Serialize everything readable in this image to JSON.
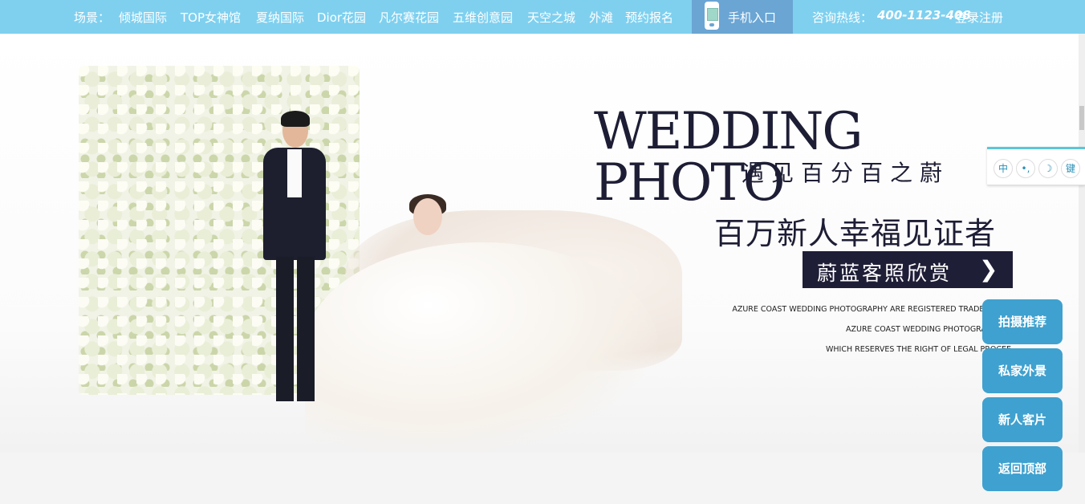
{
  "topbar": {
    "scene_label": "场景：",
    "nav_items": [
      "倾城国际",
      "TOP女神馆",
      "夏纳国际",
      "Dior花园",
      "凡尔赛花园",
      "五维创意园",
      "天空之城",
      "外滩",
      "预约报名"
    ],
    "mobile_entry": "手机入口",
    "hotline_label": "咨询热线：",
    "hotline_number": "400-1123-408",
    "login": "登录注册"
  },
  "banner": {
    "headline": "WEDDING PHOTO",
    "subtitle": "遇见百分百之蔚",
    "slogan": "百万新人幸福见证者",
    "button_label": "蔚蓝客照欣赏",
    "button_arrow": "❯",
    "trademark_lines": [
      "AZURE COAST WEDDING PHOTOGRAPHY ARE REGISTERED TRADEMARKS",
      "AZURE COAST WEDDING PHOTOGRAPHY W",
      "WHICH RESERVES THE RIGHT OF LEGAL PROCEE"
    ]
  },
  "ime": [
    "中",
    "•,",
    "☽",
    "键"
  ],
  "side_buttons": [
    "拍摄推荐",
    "私家外景",
    "新人客片",
    "返回顶部"
  ],
  "colors": {
    "topbar": "#7fd0ef",
    "mobile_entry": "#6aa5d4",
    "side_button": "#3fa1cf",
    "headline": "#1d1d35"
  }
}
